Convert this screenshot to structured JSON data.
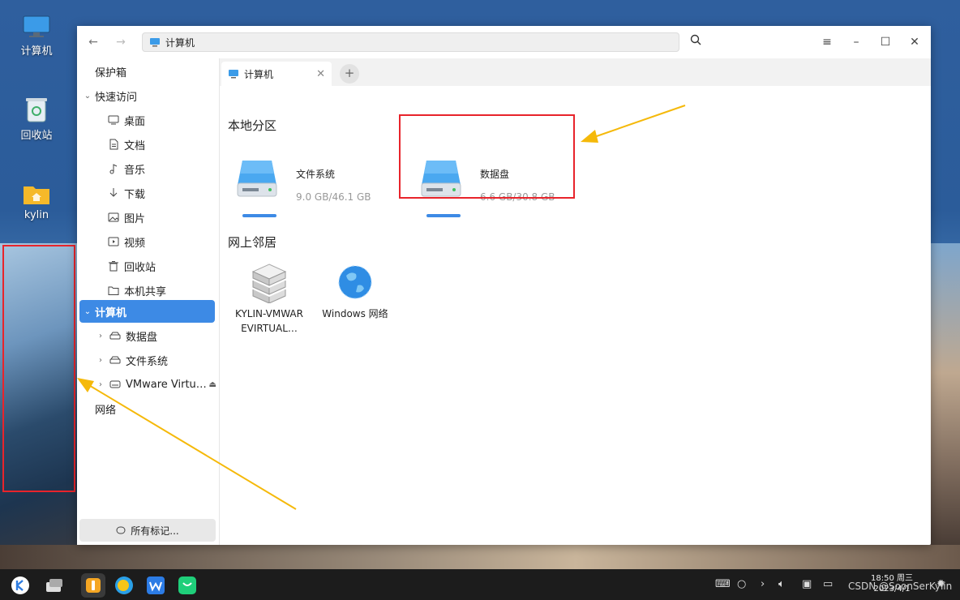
{
  "desktop": {
    "icons": [
      {
        "label": "计算机",
        "icon": "computer-icon"
      },
      {
        "label": "回收站",
        "icon": "trash-icon"
      },
      {
        "label": "kylin",
        "icon": "home-folder-icon"
      }
    ]
  },
  "window": {
    "address": "计算机",
    "colors": {
      "accent": "#3d8ae5",
      "highlight": "#e8242b",
      "arrow": "#f5b90a"
    }
  },
  "sidebar": {
    "items": [
      {
        "label": "保护箱"
      },
      {
        "label": "快速访问"
      },
      {
        "label": "桌面",
        "icon": "desktop-icon"
      },
      {
        "label": "文档",
        "icon": "document-icon"
      },
      {
        "label": "音乐",
        "icon": "music-icon"
      },
      {
        "label": "下载",
        "icon": "download-icon"
      },
      {
        "label": "图片",
        "icon": "picture-icon"
      },
      {
        "label": "视频",
        "icon": "video-icon"
      },
      {
        "label": "回收站",
        "icon": "trash-icon"
      },
      {
        "label": "本机共享",
        "icon": "folder-icon"
      },
      {
        "label": "计算机",
        "icon": "computer-icon"
      },
      {
        "label": "数据盘",
        "icon": "drive-icon"
      },
      {
        "label": "文件系统",
        "icon": "drive-icon"
      },
      {
        "label": "VMware Virtu…",
        "icon": "cdrom-icon"
      },
      {
        "label": "网络"
      }
    ],
    "tags_button": "所有标记..."
  },
  "tabs": [
    {
      "label": "计算机"
    }
  ],
  "main": {
    "local_section": "本地分区",
    "drives": [
      {
        "name": "文件系统",
        "size": "9.0 GB/46.1 GB"
      },
      {
        "name": "数据盘",
        "size": "6.6 GB/30.8 GB"
      }
    ],
    "network_section": "网上邻居",
    "network_items": [
      {
        "line1": "KYLIN-VMWAR",
        "line2": "EVIRTUAL…"
      },
      {
        "line1": "Windows 网络"
      }
    ]
  },
  "taskbar": {
    "time": "18:50 周三",
    "date": "2023/4/1",
    "watermark": "CSDN @SoonSerKylin"
  }
}
